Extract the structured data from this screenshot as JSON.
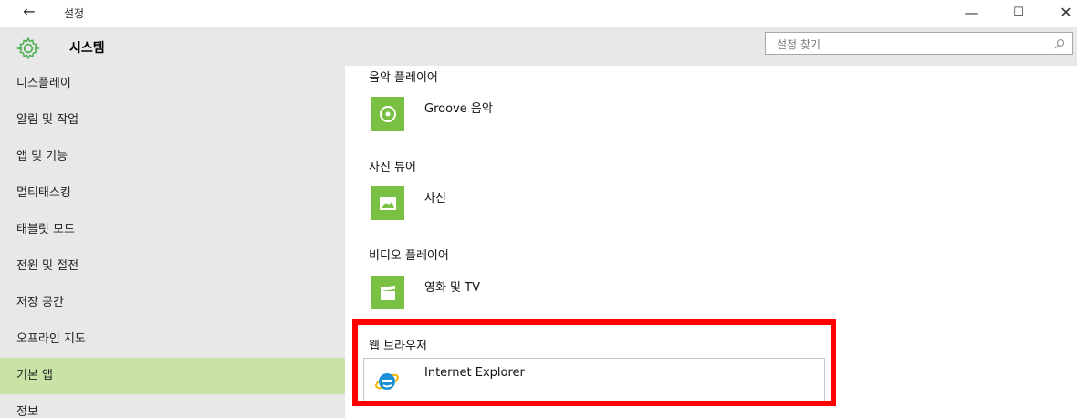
{
  "window": {
    "back_glyph": "←",
    "title": "설정",
    "minimize_glyph": "—",
    "maximize_glyph": "☐",
    "close_glyph": "✕"
  },
  "header": {
    "section_title": "시스템",
    "search_placeholder": "설정 찾기"
  },
  "sidebar": {
    "items": [
      {
        "label": "디스플레이"
      },
      {
        "label": "알림 및 작업"
      },
      {
        "label": "앱 및 기능"
      },
      {
        "label": "멀티태스킹"
      },
      {
        "label": "태블릿 모드"
      },
      {
        "label": "전원 및 절전"
      },
      {
        "label": "저장 공간"
      },
      {
        "label": "오프라인 지도"
      },
      {
        "label": "기본 앱"
      },
      {
        "label": "정보"
      }
    ],
    "selected": "기본 앱"
  },
  "content": {
    "music": {
      "category": "음악 플레이어",
      "app": "Groove 음악"
    },
    "photo": {
      "category": "사진 뷰어",
      "app": "사진"
    },
    "video": {
      "category": "비디오 플레이어",
      "app": "영화 및 TV"
    },
    "browser": {
      "category": "웹 브라우저",
      "app": "Internet Explorer"
    }
  },
  "colors": {
    "accent": "#7ac143",
    "selected_nav": "#c8e3a5",
    "highlight": "#ff0000"
  }
}
